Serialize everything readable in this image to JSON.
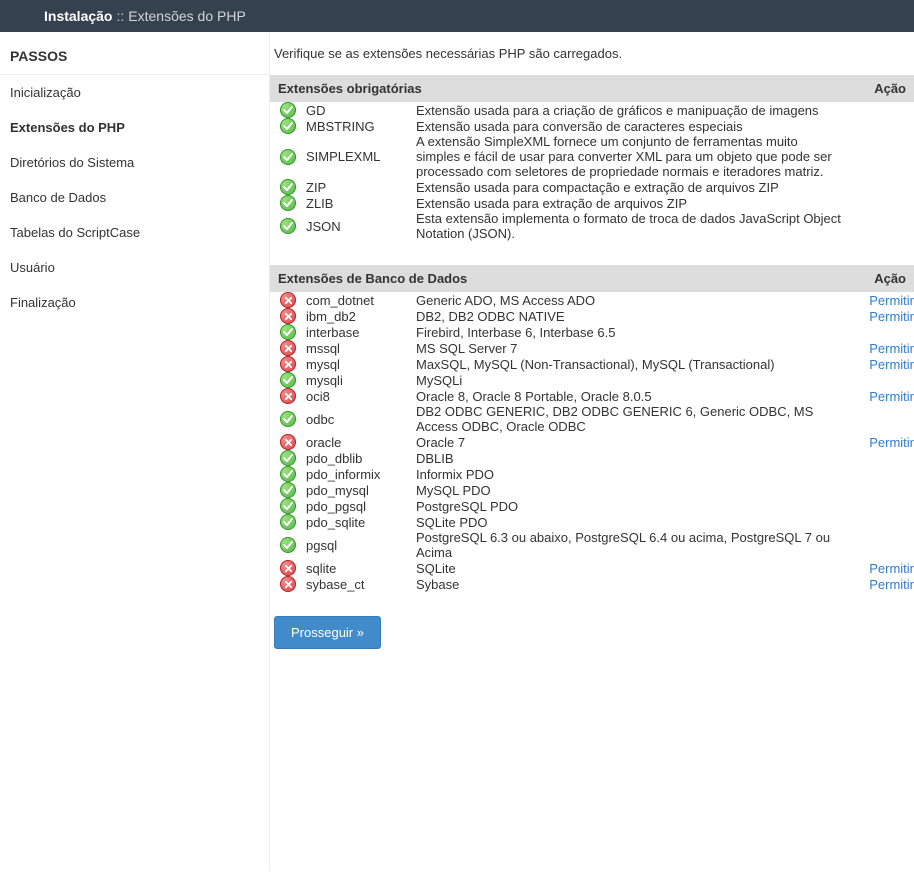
{
  "topbar": {
    "main": "Instalação",
    "separator": "::",
    "sub": "Extensões do PHP"
  },
  "sidebar": {
    "heading": "PASSOS",
    "steps": [
      {
        "label": "Inicialização",
        "active": false
      },
      {
        "label": "Extensões do PHP",
        "active": true
      },
      {
        "label": "Diretórios do Sistema",
        "active": false
      },
      {
        "label": "Banco de Dados",
        "active": false
      },
      {
        "label": "Tabelas do ScriptCase",
        "active": false
      },
      {
        "label": "Usuário",
        "active": false
      },
      {
        "label": "Finalização",
        "active": false
      }
    ]
  },
  "content": {
    "intro": "Verifique se as extensões necessárias PHP são carregados.",
    "action_label": "Permitir",
    "sections": [
      {
        "title": "Extensões obrigatórias",
        "action_header": "Ação",
        "rows": [
          {
            "status": "ok",
            "name": "GD",
            "desc": "Extensão usada para a criação de gráficos e manipuação de imagens",
            "action": false
          },
          {
            "status": "ok",
            "name": "MBSTRING",
            "desc": "Extensão usada para conversão de caracteres especiais",
            "action": false
          },
          {
            "status": "ok",
            "name": "SIMPLEXML",
            "desc": "A extensão SimpleXML fornece um conjunto de ferramentas muito simples e fácil de usar para converter XML para um objeto que pode ser processado com seletores de propriedade normais e iteradores matriz.",
            "action": false
          },
          {
            "status": "ok",
            "name": "ZIP",
            "desc": "Extensão usada para compactação e extração de arquivos ZIP",
            "action": false
          },
          {
            "status": "ok",
            "name": "ZLIB",
            "desc": "Extensão usada para extração de arquivos ZIP",
            "action": false
          },
          {
            "status": "ok",
            "name": "JSON",
            "desc": "Esta extensão implementa o formato de troca de dados JavaScript Object Notation (JSON).",
            "action": false
          }
        ]
      },
      {
        "title": "Extensões de Banco de Dados",
        "action_header": "Ação",
        "rows": [
          {
            "status": "err",
            "name": "com_dotnet",
            "desc": "Generic ADO, MS Access ADO",
            "action": true
          },
          {
            "status": "err",
            "name": "ibm_db2",
            "desc": "DB2, DB2 ODBC NATIVE",
            "action": true
          },
          {
            "status": "ok",
            "name": "interbase",
            "desc": "Firebird, Interbase 6, Interbase 6.5",
            "action": false
          },
          {
            "status": "err",
            "name": "mssql",
            "desc": "MS SQL Server 7",
            "action": true
          },
          {
            "status": "err",
            "name": "mysql",
            "desc": "MaxSQL, MySQL (Non-Transactional), MySQL (Transactional)",
            "action": true
          },
          {
            "status": "ok",
            "name": "mysqli",
            "desc": "MySQLi",
            "action": false
          },
          {
            "status": "err",
            "name": "oci8",
            "desc": "Oracle 8, Oracle 8 Portable, Oracle 8.0.5",
            "action": true
          },
          {
            "status": "ok",
            "name": "odbc",
            "desc": "DB2 ODBC GENERIC, DB2 ODBC GENERIC 6, Generic ODBC, MS Access ODBC, Oracle ODBC",
            "action": false
          },
          {
            "status": "err",
            "name": "oracle",
            "desc": "Oracle 7",
            "action": true
          },
          {
            "status": "ok",
            "name": "pdo_dblib",
            "desc": "DBLIB",
            "action": false
          },
          {
            "status": "ok",
            "name": "pdo_informix",
            "desc": "Informix PDO",
            "action": false
          },
          {
            "status": "ok",
            "name": "pdo_mysql",
            "desc": "MySQL PDO",
            "action": false
          },
          {
            "status": "ok",
            "name": "pdo_pgsql",
            "desc": "PostgreSQL PDO",
            "action": false
          },
          {
            "status": "ok",
            "name": "pdo_sqlite",
            "desc": "SQLite PDO",
            "action": false
          },
          {
            "status": "ok",
            "name": "pgsql",
            "desc": "PostgreSQL 6.3 ou abaixo, PostgreSQL 6.4 ou acima, PostgreSQL 7 ou Acima",
            "action": false
          },
          {
            "status": "err",
            "name": "sqlite",
            "desc": "SQLite",
            "action": true
          },
          {
            "status": "err",
            "name": "sybase_ct",
            "desc": "Sybase",
            "action": true
          }
        ]
      }
    ],
    "proceed_button": "Prosseguir »"
  }
}
